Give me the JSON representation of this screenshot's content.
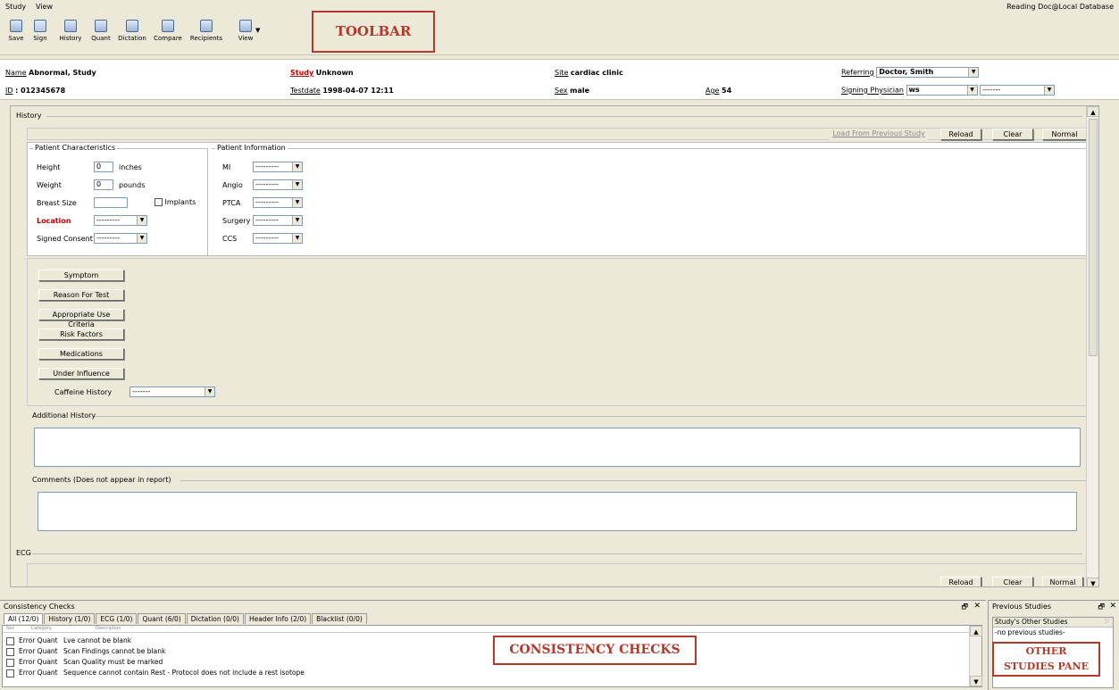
{
  "menubar": {
    "items": [
      "Study",
      "View"
    ],
    "db_label": "Reading Doc@Local Database"
  },
  "toolbar": {
    "buttons": [
      "Save",
      "Sign",
      "History",
      "Quant",
      "Dictation",
      "Compare",
      "Recipients",
      "View"
    ],
    "annotation": "TOOLBAR"
  },
  "header": {
    "name_label": "Name",
    "name_value": "Abnormal, Study",
    "id_label": "ID",
    "id_value": ": 012345678",
    "study_label": "Study",
    "study_value": "Unknown",
    "testdate_label": "Testdate",
    "testdate_value": "1998-04-07 12:11",
    "site_label": "Site",
    "site_value": "cardiac clinic",
    "sex_label": "Sex",
    "sex_value": "male",
    "age_label": "Age",
    "age_value": "54",
    "referring_label": "Referring",
    "referring_value": "Doctor, Smith",
    "signing_label": "Signing Physician",
    "signing_value": "ws",
    "signing_value2": "-------"
  },
  "history": {
    "title": "History",
    "actions": {
      "load_prev": "Load From Previous Study",
      "reload": "Reload",
      "clear": "Clear",
      "normal": "Normal"
    },
    "patient_chars": {
      "title": "Patient Characteristics",
      "height_label": "Height",
      "height_value": "0",
      "height_unit": "inches",
      "weight_label": "Weight",
      "weight_value": "0",
      "weight_unit": "pounds",
      "breast_label": "Breast Size",
      "implants_label": "Implants",
      "location_label": "Location",
      "location_value": "---------",
      "consent_label": "Signed Consent",
      "consent_value": "---------"
    },
    "patient_info": {
      "title": "Patient Information",
      "mi_label": "MI",
      "mi_value": "---------",
      "angio_label": "Angio",
      "angio_value": "---------",
      "ptca_label": "PTCA",
      "ptca_value": "---------",
      "surgery_label": "Surgery",
      "surgery_value": "---------",
      "ccs_label": "CCS",
      "ccs_value": "---------"
    },
    "buttons": [
      "Symptom",
      "Reason For Test",
      "Appropriate Use Criteria",
      "Risk Factors",
      "Medications",
      "Under Influence"
    ],
    "caffeine_label": "Caffeine History",
    "caffeine_value": "-------",
    "additional_title": "Additional History",
    "comments_title": "Comments (Does not appear in report)"
  },
  "ecg": {
    "title": "ECG",
    "actions": {
      "reload": "Reload",
      "clear": "Clear",
      "normal": "Normal"
    }
  },
  "consistency": {
    "title": "Consistency Checks",
    "tabs": [
      "All (12/0)",
      "History (1/0)",
      "ECG (1/0)",
      "Quant (6/0)",
      "Dictation (0/0)",
      "Header Info (2/0)",
      "Blacklist (0/0)"
    ],
    "columns": [
      "Sev",
      "Category",
      "Description"
    ],
    "rows": [
      {
        "sev": "Error",
        "cat": "Quant",
        "desc": "Lve cannot be blank"
      },
      {
        "sev": "Error",
        "cat": "Quant",
        "desc": "Scan Findings cannot be blank"
      },
      {
        "sev": "Error",
        "cat": "Quant",
        "desc": "Scan Quality must be marked"
      },
      {
        "sev": "Error",
        "cat": "Quant",
        "desc": "Sequence cannot contain Rest - Protocol does not include a rest isotope"
      }
    ],
    "annotation": "CONSISTENCY CHECKS"
  },
  "previous": {
    "title": "Previous Studies",
    "subtitle": "Study's Other Studies",
    "empty": "-no previous studies-",
    "annotation_line1": "OTHER",
    "annotation_line2": "STUDIES PANE"
  },
  "icons": {
    "pin": "pin-icon",
    "close": "close-icon"
  }
}
